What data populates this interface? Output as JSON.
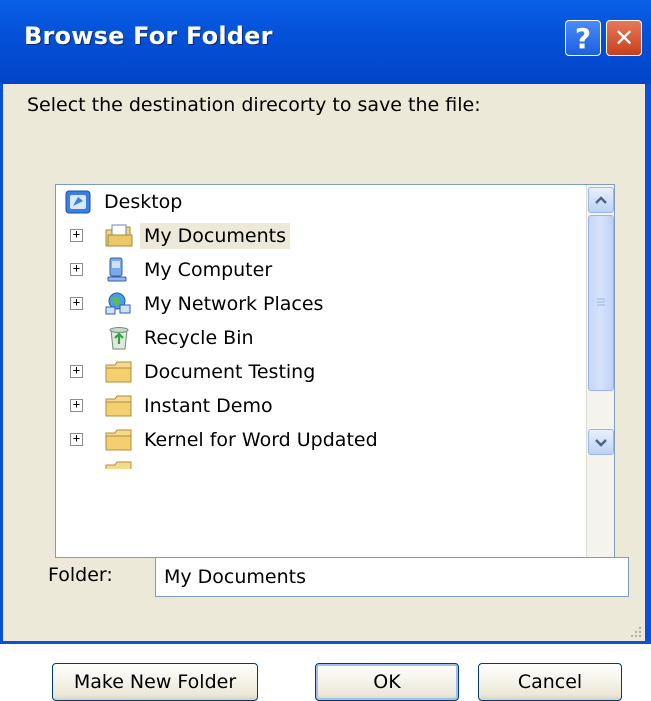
{
  "window": {
    "title": "Browse For Folder",
    "help_glyph": "?",
    "close_glyph": "✕"
  },
  "dialog": {
    "prompt": "Select the destination direcorty to save the file:",
    "tree": {
      "items": [
        {
          "label": "Desktop",
          "icon": "desktop-icon",
          "expander": ""
        },
        {
          "label": "My Documents",
          "icon": "my-documents-icon",
          "expander": "+",
          "selected": true
        },
        {
          "label": "My Computer",
          "icon": "my-computer-icon",
          "expander": "+"
        },
        {
          "label": "My Network Places",
          "icon": "network-places-icon",
          "expander": "+"
        },
        {
          "label": "Recycle Bin",
          "icon": "recycle-bin-icon",
          "expander": ""
        },
        {
          "label": "Document Testing",
          "icon": "folder-icon",
          "expander": "+"
        },
        {
          "label": "Instant Demo",
          "icon": "folder-icon",
          "expander": "+"
        },
        {
          "label": "Kernel for Word Updated",
          "icon": "folder-icon",
          "expander": "+"
        }
      ]
    },
    "folder": {
      "label": "Folder:",
      "value": "My Documents"
    },
    "buttons": {
      "make_new_folder": "Make New Folder",
      "ok": "OK",
      "cancel": "Cancel"
    }
  },
  "colors": {
    "titlebar": "#0450d6",
    "face": "#ece9d8",
    "close": "#c8401c"
  }
}
